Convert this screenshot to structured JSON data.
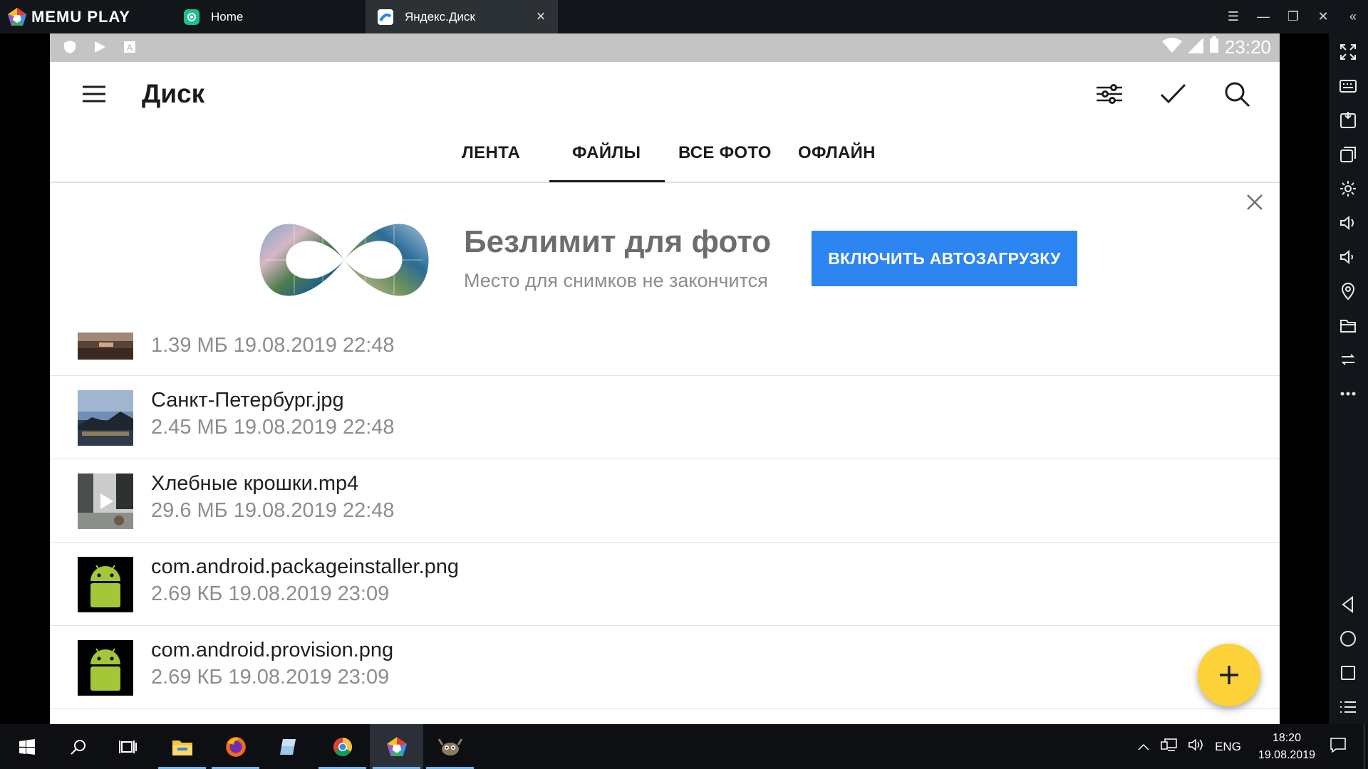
{
  "emulator": {
    "brand": "MEMU PLAY",
    "tabs": [
      {
        "label": "Home",
        "icon": "home-app-icon"
      },
      {
        "label": "Яндекс.Диск",
        "icon": "yandex-disk-icon"
      }
    ],
    "window_controls": [
      "menu-icon",
      "minimize-icon",
      "restore-icon",
      "close-icon",
      "collapse-sidebar-icon"
    ],
    "sidebar_tools": [
      "fullscreen-icon",
      "keyboard-mapping-icon",
      "install-apk-icon",
      "multi-window-icon",
      "settings-icon",
      "volume-up-icon",
      "volume-down-icon",
      "location-icon",
      "shared-folder-icon",
      "rotate-icon",
      "more-icon",
      "back-icon",
      "home-icon",
      "recents-icon",
      "menu-list-icon"
    ]
  },
  "android_status": {
    "time": "23:20",
    "icons": [
      "shield-icon",
      "play-store-icon",
      "a-icon",
      "wifi-icon",
      "signal-icon",
      "battery-icon"
    ]
  },
  "app": {
    "title": "Диск",
    "actions": [
      "filter-icon",
      "select-check-icon",
      "search-icon"
    ],
    "tabs": [
      {
        "label": "ЛЕНТА",
        "active": false
      },
      {
        "label": "ФАЙЛЫ",
        "active": true
      },
      {
        "label": "ВСЕ ФОТО",
        "active": false
      },
      {
        "label": "ОФЛАЙН",
        "active": false
      }
    ]
  },
  "promo": {
    "title": "Безлимит для фото",
    "subtitle": "Место для снимков не закончится",
    "button": "ВКЛЮЧИТЬ АВТОЗАГРУЗКУ",
    "button_color": "#2c85f0"
  },
  "files": [
    {
      "name": "",
      "meta": "1.39 МБ 19.08.2019 22:48",
      "thumb": "photo"
    },
    {
      "name": "Санкт-Петербург.jpg",
      "meta": "2.45 МБ 19.08.2019 22:48",
      "thumb": "photo"
    },
    {
      "name": "Хлебные крошки.mp4",
      "meta": "29.6 МБ 19.08.2019 22:48",
      "thumb": "video"
    },
    {
      "name": "com.android.packageinstaller.png",
      "meta": "2.69 КБ 19.08.2019 23:09",
      "thumb": "android"
    },
    {
      "name": "com.android.provision.png",
      "meta": "2.69 КБ 19.08.2019 23:09",
      "thumb": "android"
    }
  ],
  "fab": {
    "icon": "plus-icon",
    "color": "#fcd238"
  },
  "taskbar": {
    "apps": [
      "windows-start-icon",
      "search-icon",
      "task-view-icon",
      "file-explorer-icon",
      "firefox-icon",
      "notepad-icon",
      "chrome-icon",
      "memu-icon",
      "gimp-icon"
    ],
    "language": "ENG",
    "time": "18:20",
    "date": "19.08.2019"
  }
}
